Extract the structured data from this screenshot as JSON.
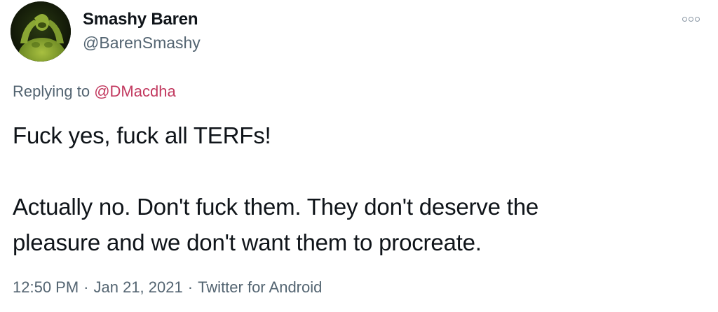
{
  "user": {
    "display_name": "Smashy Baren",
    "handle": "@BarenSmashy",
    "avatar_icon": "profile-photo"
  },
  "reply": {
    "prefix": "Replying to ",
    "to_handle": "@DMacdha"
  },
  "tweet": {
    "lines": [
      "Fuck yes, fuck all TERFs!",
      "Actually no. Don't fuck them. They don't deserve the",
      "pleasure and we don't want them to procreate."
    ]
  },
  "meta": {
    "time": "12:50 PM",
    "date": "Jan 21, 2021",
    "separator": "·",
    "source": "Twitter for Android"
  },
  "colors": {
    "text": "#0f1419",
    "secondary": "#536471",
    "link": "#c2395f"
  }
}
